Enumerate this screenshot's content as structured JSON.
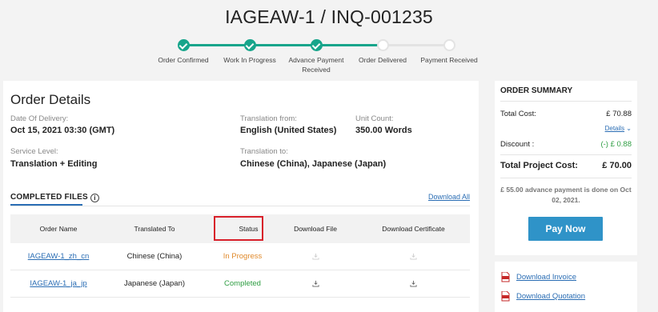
{
  "header": {
    "title": "IAGEAW-1 / INQ-001235"
  },
  "progress": {
    "steps": [
      {
        "label": "Order Confirmed",
        "status": "done"
      },
      {
        "label": "Work In Progress",
        "status": "done"
      },
      {
        "label": "Advance Payment Received",
        "status": "done"
      },
      {
        "label": "Order Delivered",
        "status": "pending"
      },
      {
        "label": "Payment Received",
        "status": "pending"
      }
    ],
    "colors": {
      "done": "#17a58b",
      "pending": "#e3e3e3"
    }
  },
  "order_details": {
    "title": "Order Details",
    "date_of_delivery": {
      "label": "Date Of Delivery:",
      "value": "Oct 15, 2021 03:30 (GMT)"
    },
    "translation_from": {
      "label": "Translation from:",
      "value": "English (United States)"
    },
    "unit_count": {
      "label": "Unit Count:",
      "value": "350.00 Words"
    },
    "service_level": {
      "label": "Service Level:",
      "value": "Translation + Editing"
    },
    "translation_to": {
      "label": "Translation to:",
      "value": "Chinese (China), Japanese (Japan)"
    }
  },
  "completed_files": {
    "title": "COMPLETED FILES",
    "info_icon": "info-icon",
    "download_all": "Download All",
    "columns": [
      "Order Name",
      "Translated To",
      "Status",
      "Download File",
      "Download Certificate"
    ],
    "rows": [
      {
        "order_name": "IAGEAW-1_zh_cn",
        "translated_to": "Chinese (China)",
        "status": "In Progress",
        "status_color": "#e08a2c",
        "downloads_enabled": false
      },
      {
        "order_name": "IAGEAW-1_ja_jp",
        "translated_to": "Japanese (Japan)",
        "status": "Completed",
        "status_color": "#2e9d42",
        "downloads_enabled": true
      }
    ]
  },
  "order_summary": {
    "title": "ORDER SUMMARY",
    "total_cost": {
      "label": "Total Cost:",
      "value": "£ 70.88"
    },
    "details_link": "Details",
    "discount": {
      "label": "Discount :",
      "value": "(-) £ 0.88"
    },
    "total_project_cost": {
      "label": "Total Project Cost:",
      "value": "£ 70.00"
    },
    "advance_note": "£ 55.00 advance payment is done on Oct 02, 2021.",
    "pay_now": "Pay Now"
  },
  "document_links": [
    {
      "label": "Download Invoice",
      "icon": "pdf-icon"
    },
    {
      "label": "Download Quotation",
      "icon": "pdf-icon"
    }
  ]
}
